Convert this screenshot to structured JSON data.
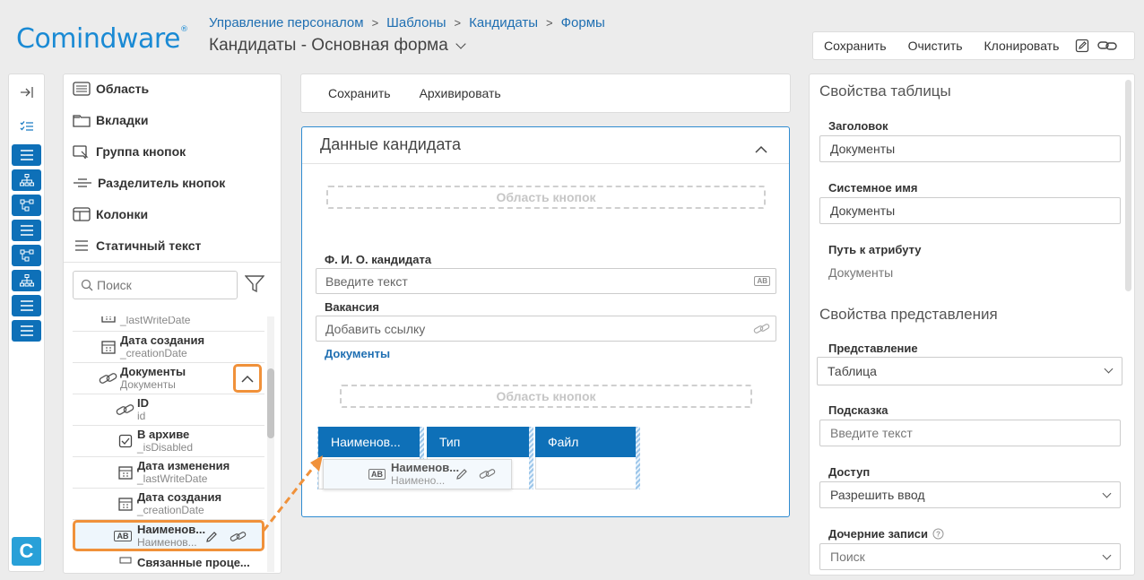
{
  "app": {
    "brand": "Comindware",
    "trademark": "®"
  },
  "breadcrumb": [
    "Управление персоналом",
    "Шаблоны",
    "Кандидаты",
    "Формы"
  ],
  "page_title": "Кандидаты - Основная форма",
  "top_toolbar": {
    "save": "Сохранить",
    "clear": "Очистить",
    "clone": "Клонировать",
    "icons": [
      "edit-icon",
      "link-icon"
    ]
  },
  "rail_icons": [
    "collapse-panel-icon",
    "checklist-icon",
    "form-list-icon",
    "hierarchy-icon",
    "process-icon",
    "form-list-icon",
    "process-icon",
    "hierarchy-icon",
    "form-list-icon",
    "form-list-icon",
    "brand-c-icon"
  ],
  "rail_brand_letter": "C",
  "components": {
    "items": [
      {
        "label": "Область",
        "icon": "area-icon"
      },
      {
        "label": "Вкладки",
        "icon": "tabs-icon"
      },
      {
        "label": "Группа кнопок",
        "icon": "button-group-icon"
      },
      {
        "label": "Разделитель кнопок",
        "icon": "button-separator-icon"
      },
      {
        "label": "Колонки",
        "icon": "columns-icon"
      },
      {
        "label": "Статичный текст",
        "icon": "static-text-icon"
      }
    ],
    "search_placeholder": "Поиск"
  },
  "tree": [
    {
      "title": "",
      "sub": "_lastWriteDate",
      "icon": "calendar-icon"
    },
    {
      "title": "Дата создания",
      "sub": "_creationDate",
      "icon": "calendar-icon"
    },
    {
      "title": "Документы",
      "sub": "Документы",
      "icon": "link-icon"
    },
    {
      "title": "ID",
      "sub": "id",
      "icon": "link-icon"
    },
    {
      "title": "В архиве",
      "sub": "_isDisabled",
      "icon": "checkbox-icon"
    },
    {
      "title": "Дата изменения",
      "sub": "_lastWriteDate",
      "icon": "calendar-icon"
    },
    {
      "title": "Дата создания",
      "sub": "_creationDate",
      "icon": "calendar-icon"
    },
    {
      "title": "Наименов...",
      "sub": "Наименов...",
      "icon": "text-field-icon",
      "badge": "AB"
    },
    {
      "title": "Связанные проце...",
      "sub": "",
      "icon": "process-icon"
    }
  ],
  "form_toolbar": {
    "save": "Сохранить",
    "archive": "Архивировать"
  },
  "card": {
    "title": "Данные кандидата",
    "button_area": "Область кнопок",
    "fields": [
      {
        "label": "Ф. И. О. кандидата",
        "placeholder": "Введите текст",
        "badge": "AB"
      },
      {
        "label": "Вакансия",
        "placeholder": "Добавить ссылку"
      }
    ],
    "documents_label": "Документы",
    "table_columns": [
      "Наименов...",
      "Тип",
      "Файл"
    ],
    "ghost": {
      "badge": "AB",
      "title": "Наименов...",
      "sub": "Наимено..."
    }
  },
  "props": {
    "table_section": "Свойства таблицы",
    "header_label": "Заголовок",
    "header_value": "Документы",
    "system_name_label": "Системное имя",
    "system_name_value": "Документы",
    "path_label": "Путь к атрибуту",
    "path_value": "Документы",
    "view_section": "Свойства представления",
    "representation_label": "Представление",
    "representation_value": "Таблица",
    "hint_label": "Подсказка",
    "hint_placeholder": "Введите текст",
    "access_label": "Доступ",
    "access_value": "Разрешить ввод",
    "child_records_label": "Дочерние записи",
    "child_records_value": "Поиск"
  },
  "colors": {
    "brand": "#1a8ad4",
    "accent": "#0e70b8",
    "highlight": "#f0913a",
    "link": "#1f6fb2"
  }
}
